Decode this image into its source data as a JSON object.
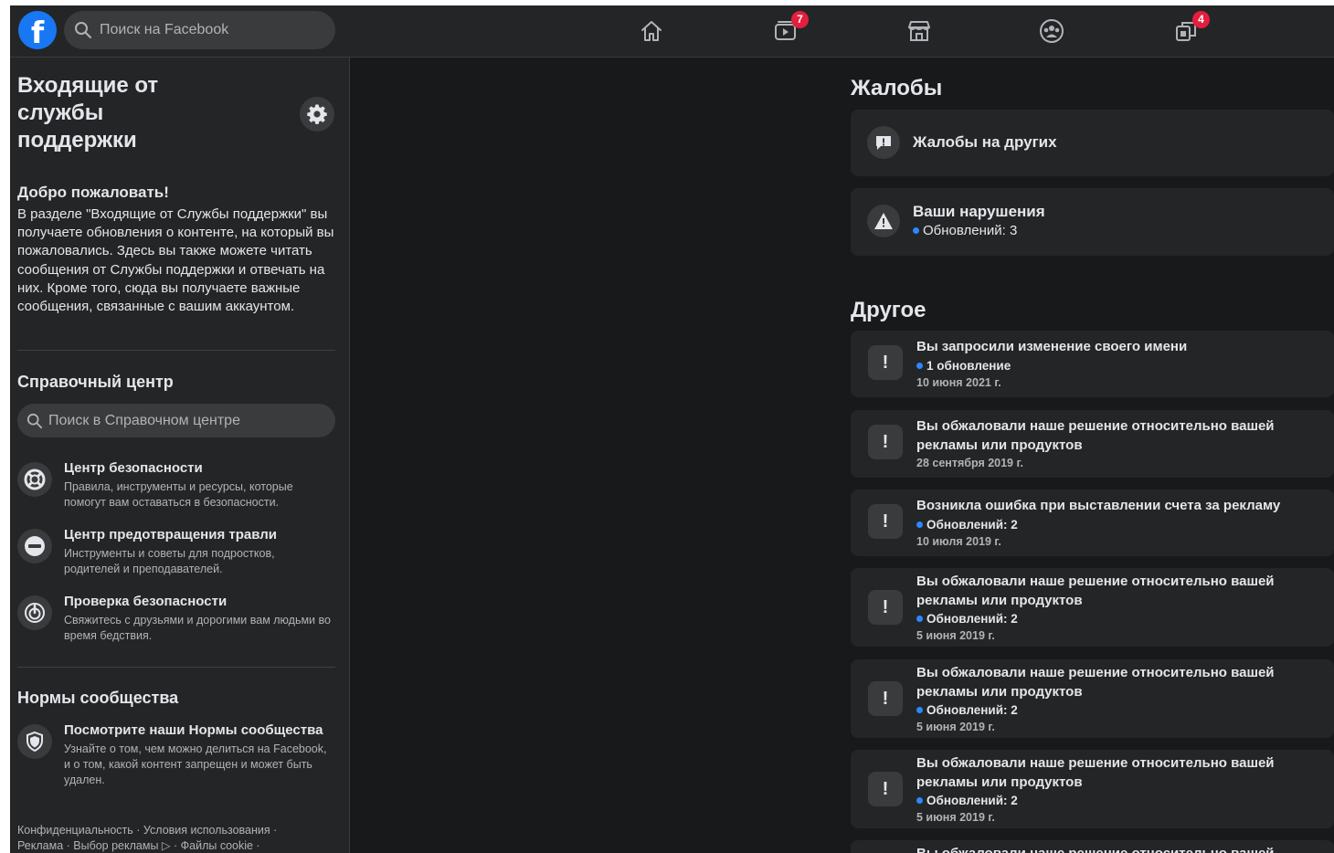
{
  "topbar": {
    "search_placeholder": "Поиск на Facebook",
    "nav": [
      {
        "name": "home",
        "icon": "home-icon",
        "badge": ""
      },
      {
        "name": "watch",
        "icon": "video-icon",
        "badge": "7"
      },
      {
        "name": "marketplace",
        "icon": "store-icon",
        "badge": ""
      },
      {
        "name": "groups",
        "icon": "groups-icon",
        "badge": ""
      },
      {
        "name": "gaming",
        "icon": "gaming-icon",
        "badge": "4"
      }
    ],
    "colors": {
      "brand": "#1877f2",
      "badge": "#e41e3f"
    }
  },
  "sidebar": {
    "title": "Входящие от службы поддержки",
    "welcome_heading": "Добро пожаловать!",
    "welcome_text": "В разделе \"Входящие от Службы поддержки\" вы получаете обновления о контенте, на который вы пожаловались. Здесь вы также можете читать сообщения от Службы поддержки и отвечать на них. Кроме того, сюда вы получаете важные сообщения, связанные с вашим аккаунтом.",
    "help_center_title": "Справочный центр",
    "help_search_placeholder": "Поиск в Справочном центре",
    "help_items": [
      {
        "icon": "lifebuoy-icon",
        "title": "Центр безопасности",
        "desc": "Правила, инструменты и ресурсы, которые помогут вам оставаться в безопасности."
      },
      {
        "icon": "no-entry-icon",
        "title": "Центр предотвращения травли",
        "desc": "Инструменты и советы для подростков, родителей и преподавателей."
      },
      {
        "icon": "safety-check-icon",
        "title": "Проверка безопасности",
        "desc": "Свяжитесь с друзьями и дорогими вам людьми во время бедствия."
      }
    ],
    "community_title": "Нормы сообщества",
    "community_item": {
      "icon": "shield-icon",
      "title": "Посмотрите наши Нормы сообщества",
      "desc": "Узнайте о том, чем можно делиться на Facebook, и о том, какой контент запрещен и может быть удален."
    },
    "footer": "Конфиденциальность · Условия использования · Реклама · Выбор рекламы ▷ · Файлы cookie ·"
  },
  "reports": {
    "heading": "Жалобы",
    "items": [
      {
        "icon": "report-icon",
        "title": "Жалобы на других",
        "sub": ""
      },
      {
        "icon": "warning-icon",
        "title": "Ваши нарушения",
        "sub": "Обновлений: 3"
      }
    ]
  },
  "other": {
    "heading": "Другое",
    "items": [
      {
        "icon": "exclamation-icon",
        "title": "Вы запросили изменение своего имени",
        "update": "1 обновление",
        "date": "10 июня 2021 г."
      },
      {
        "icon": "exclamation-icon",
        "title": "Вы обжаловали наше решение относительно вашей рекламы или продуктов",
        "update": "",
        "date": "28 сентября 2019 г."
      },
      {
        "icon": "exclamation-icon",
        "title": "Возникла ошибка при выставлении счета за рекламу",
        "update": "Обновлений: 2",
        "date": "10 июля 2019 г."
      },
      {
        "icon": "exclamation-icon",
        "title": "Вы обжаловали наше решение относительно вашей рекламы или продуктов",
        "update": "Обновлений: 2",
        "date": "5 июня 2019 г."
      },
      {
        "icon": "exclamation-icon",
        "title": "Вы обжаловали наше решение относительно вашей рекламы или продуктов",
        "update": "Обновлений: 2",
        "date": "5 июня 2019 г."
      },
      {
        "icon": "exclamation-icon",
        "title": "Вы обжаловали наше решение относительно вашей рекламы или продуктов",
        "update": "Обновлений: 2",
        "date": "5 июня 2019 г."
      },
      {
        "icon": "exclamation-icon",
        "title": "Вы обжаловали наше решение относительно вашей",
        "update": "",
        "date": ""
      }
    ]
  }
}
